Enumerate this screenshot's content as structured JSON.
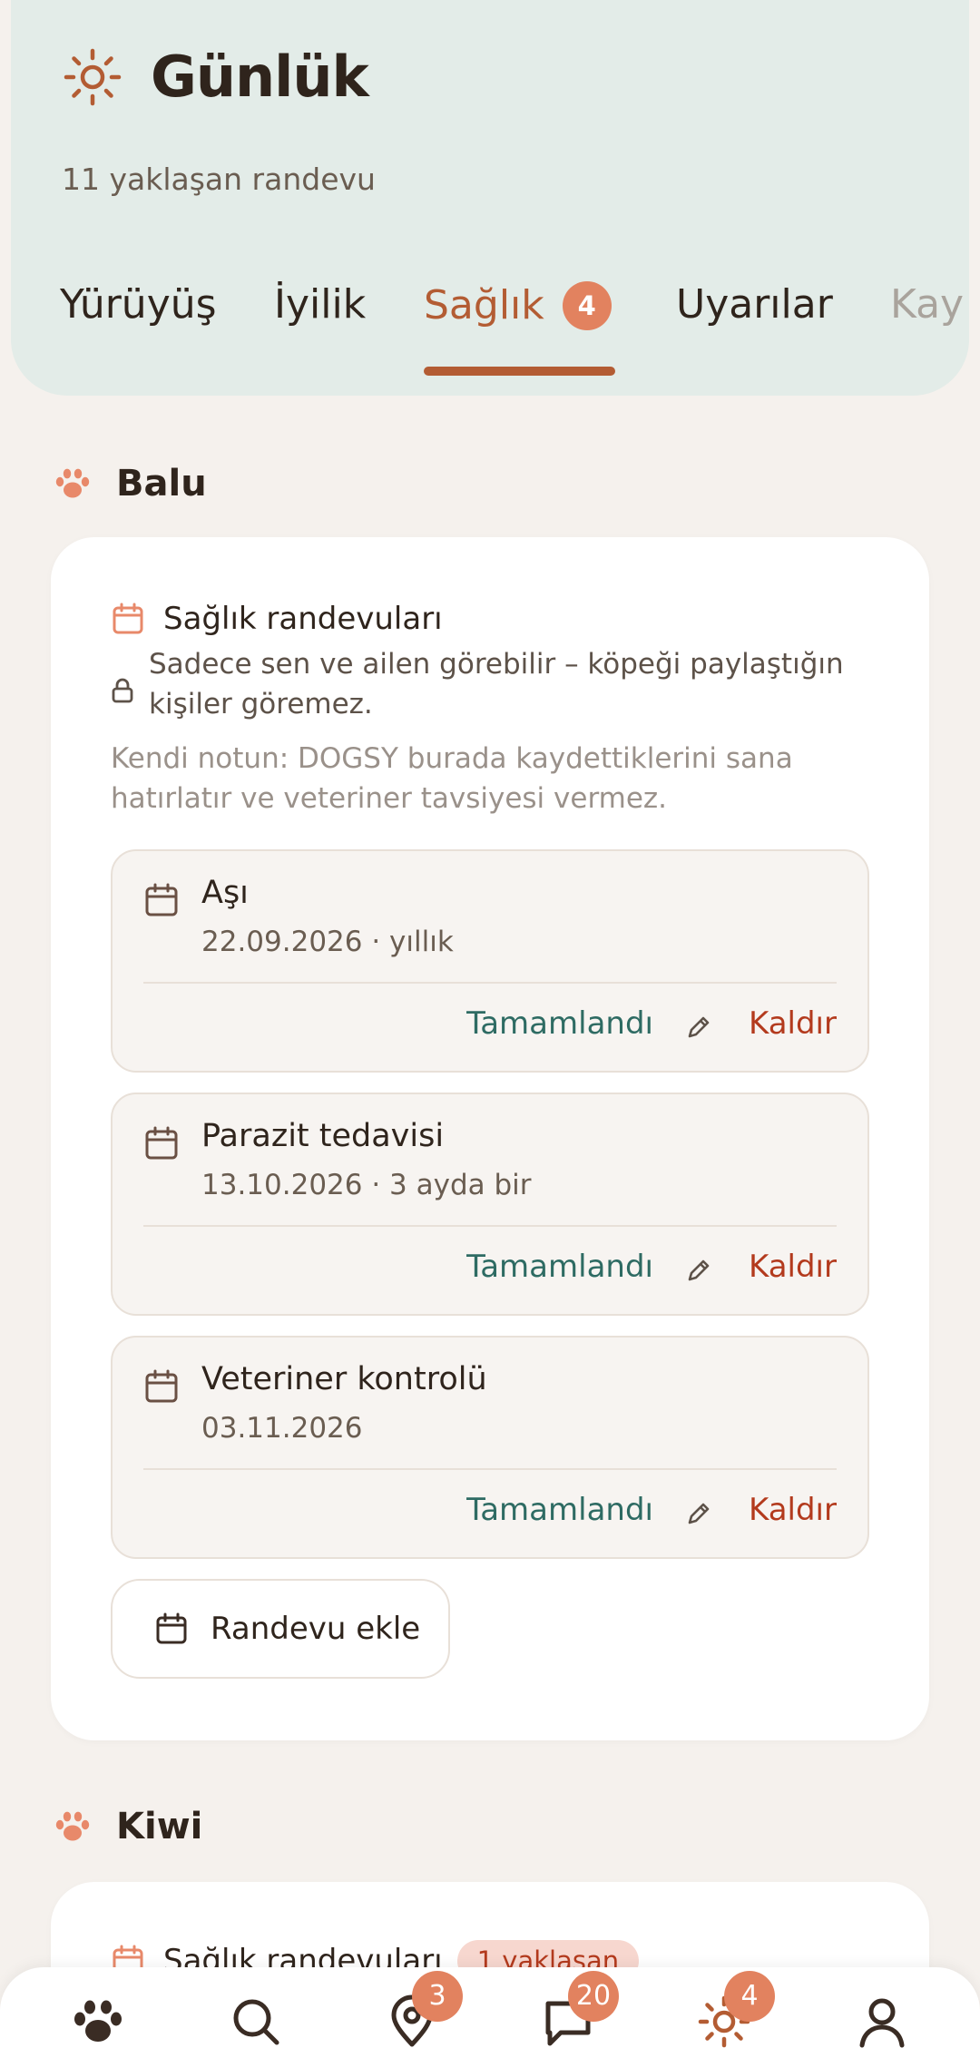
{
  "header": {
    "title": "Günlük",
    "subtitle": "11 yaklaşan randevu"
  },
  "tabs": [
    {
      "label": "Yürüyüş"
    },
    {
      "label": "İyilik"
    },
    {
      "label": "Sağlık",
      "badge": "4",
      "active": true
    },
    {
      "label": "Uyarılar"
    },
    {
      "label": "Kay"
    }
  ],
  "pets": [
    {
      "name": "Balu",
      "section_title": "Sağlık randevuları",
      "privacy": "Sadece sen ve ailen görebilir – köpeği paylaştığın kişiler göremez.",
      "note": "Kendi notun: DOGSY burada kaydettiklerini sana hatırlatır ve veteriner tavsiyesi vermez.",
      "appointments": [
        {
          "title": "Aşı",
          "date": "22.09.2026 · yıllık",
          "done_label": "Tamamlandı",
          "remove_label": "Kaldır"
        },
        {
          "title": "Parazit tedavisi",
          "date": "13.10.2026 · 3 ayda bir",
          "done_label": "Tamamlandı",
          "remove_label": "Kaldır"
        },
        {
          "title": "Veteriner kontrolü",
          "date": "03.11.2026",
          "done_label": "Tamamlandı",
          "remove_label": "Kaldır"
        }
      ],
      "add_label": "Randevu ekle"
    },
    {
      "name": "Kiwi",
      "section_title": "Sağlık randevuları",
      "badge": "1 yaklaşan"
    }
  ],
  "bottom_nav": [
    {
      "icon": "paw-icon"
    },
    {
      "icon": "search-icon"
    },
    {
      "icon": "map-pin-icon",
      "badge": "3"
    },
    {
      "icon": "chat-icon",
      "badge": "20"
    },
    {
      "icon": "sun-icon",
      "badge": "4",
      "active": true
    },
    {
      "icon": "profile-icon"
    }
  ],
  "colors": {
    "accent": "#b35c33",
    "header_bg": "#e3ece8",
    "badge": "#e2825f",
    "done": "#2e6b63",
    "remove": "#b33a1d"
  }
}
